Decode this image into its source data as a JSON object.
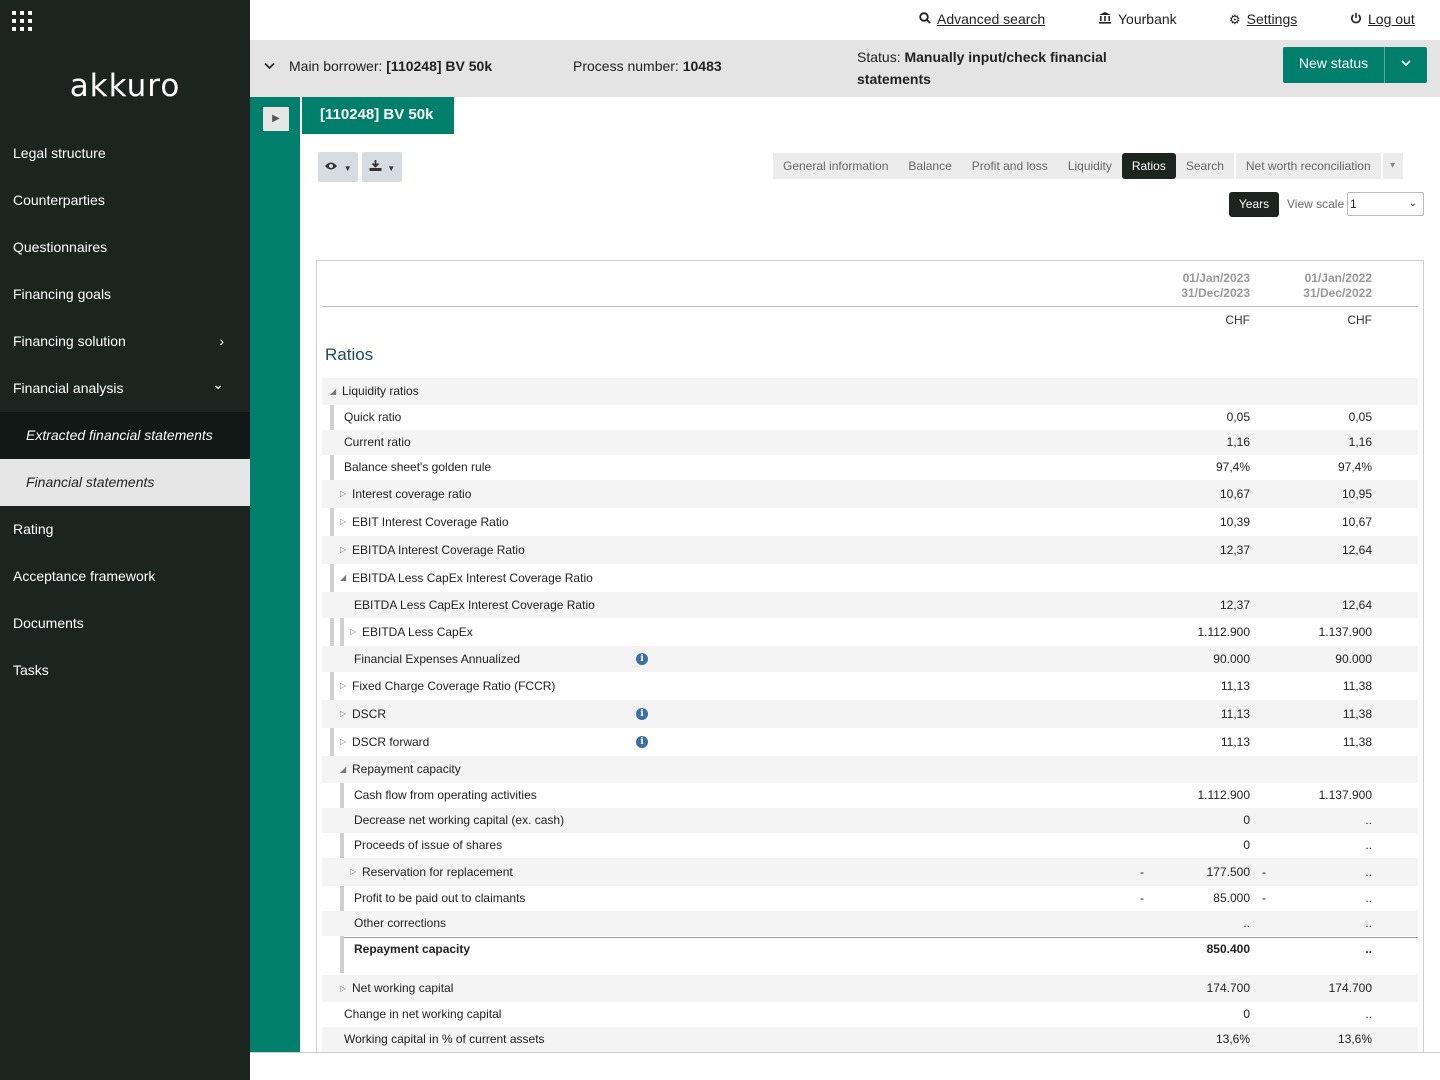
{
  "sidebar": {
    "logo": "akkuro",
    "items": [
      {
        "label": "Legal structure"
      },
      {
        "label": "Counterparties"
      },
      {
        "label": "Questionnaires"
      },
      {
        "label": "Financing goals"
      },
      {
        "label": "Financing solution",
        "chevron": "›"
      },
      {
        "label": "Financial analysis",
        "chevron": "⌄"
      },
      {
        "label": "Extracted financial statements"
      },
      {
        "label": "Financial statements"
      },
      {
        "label": "Rating"
      },
      {
        "label": "Acceptance framework"
      },
      {
        "label": "Documents"
      },
      {
        "label": "Tasks"
      }
    ]
  },
  "topbar": {
    "advanced_search": "Advanced search",
    "bank": "Yourbank",
    "settings": "Settings",
    "logout": "Log out"
  },
  "statusbar": {
    "borrower_label": "Main borrower:",
    "borrower_value": "[110248] BV 50k",
    "process_label": "Process number:",
    "process_value": "10483",
    "status_label": "Status:",
    "status_value": "Manually input/check financial statements",
    "new_status": "New status"
  },
  "entity_tab": "[110248] BV 50k",
  "tabs": [
    "General information",
    "Balance",
    "Profit and loss",
    "Liquidity",
    "Ratios",
    "Search",
    "Net worth reconciliation"
  ],
  "active_tab": "Ratios",
  "view": {
    "years": "Years",
    "view_scale_label": "View scale",
    "view_scale_value": "1"
  },
  "table": {
    "col1_from": "01/Jan/2023",
    "col1_to": "31/Dec/2023",
    "col2_from": "01/Jan/2022",
    "col2_to": "31/Dec/2022",
    "currency1": "CHF",
    "currency2": "CHF",
    "title": "Ratios",
    "rows": [
      {
        "label": "Liquidity ratios",
        "v1": "",
        "v2": ""
      },
      {
        "label": "Quick ratio",
        "v1": "0,05",
        "v2": "0,05"
      },
      {
        "label": "Current ratio",
        "v1": "1,16",
        "v2": "1,16"
      },
      {
        "label": "Balance sheet's golden rule",
        "v1": "97,4%",
        "v2": "97,4%"
      },
      {
        "label": "Interest coverage ratio",
        "v1": "10,67",
        "v2": "10,95"
      },
      {
        "label": "EBIT Interest Coverage Ratio",
        "v1": "10,39",
        "v2": "10,67"
      },
      {
        "label": "EBITDA Interest Coverage Ratio",
        "v1": "12,37",
        "v2": "12,64"
      },
      {
        "label": "EBITDA Less CapEx Interest Coverage Ratio",
        "v1": "",
        "v2": ""
      },
      {
        "label": "EBITDA Less CapEx Interest Coverage Ratio",
        "v1": "12,37",
        "v2": "12,64"
      },
      {
        "label": "EBITDA Less CapEx",
        "v1": "1.112.900",
        "v2": "1.137.900"
      },
      {
        "label": "Financial Expenses Annualized",
        "v1": "90.000",
        "v2": "90.000"
      },
      {
        "label": "Fixed Charge Coverage Ratio (FCCR)",
        "v1": "11,13",
        "v2": "11,38"
      },
      {
        "label": "DSCR",
        "v1": "11,13",
        "v2": "11,38"
      },
      {
        "label": "DSCR forward",
        "v1": "11,13",
        "v2": "11,38"
      },
      {
        "label": "Repayment capacity",
        "v1": "",
        "v2": ""
      },
      {
        "label": "Cash flow from operating activities",
        "v1": "1.112.900",
        "v2": "1.137.900"
      },
      {
        "label": "Decrease net working capital (ex. cash)",
        "v1": "0",
        "v2": ".."
      },
      {
        "label": "Proceeds of issue of shares",
        "v1": "0",
        "v2": ".."
      },
      {
        "label": "Reservation for replacement",
        "m1": "-",
        "v1": "177.500",
        "m2": "-",
        "v2": ".."
      },
      {
        "label": "Profit to be paid out to claimants",
        "m1": "-",
        "v1": "85.000",
        "m2": "-",
        "v2": ".."
      },
      {
        "label": "Other corrections",
        "v1": "..",
        "v2": ".."
      },
      {
        "label": "Repayment capacity",
        "v1": "850.400",
        "v2": ".."
      },
      {
        "label": "Net working capital",
        "v1": "174.700",
        "v2": "174.700"
      },
      {
        "label": "Change in net working capital",
        "v1": "0",
        "v2": ".."
      },
      {
        "label": "Working capital in % of current assets",
        "v1": "13,6%",
        "v2": "13,6%"
      }
    ]
  },
  "colors": {
    "sidebar_bg": "#1c2420",
    "accent": "#00806c",
    "info": "#3c6fa5"
  }
}
